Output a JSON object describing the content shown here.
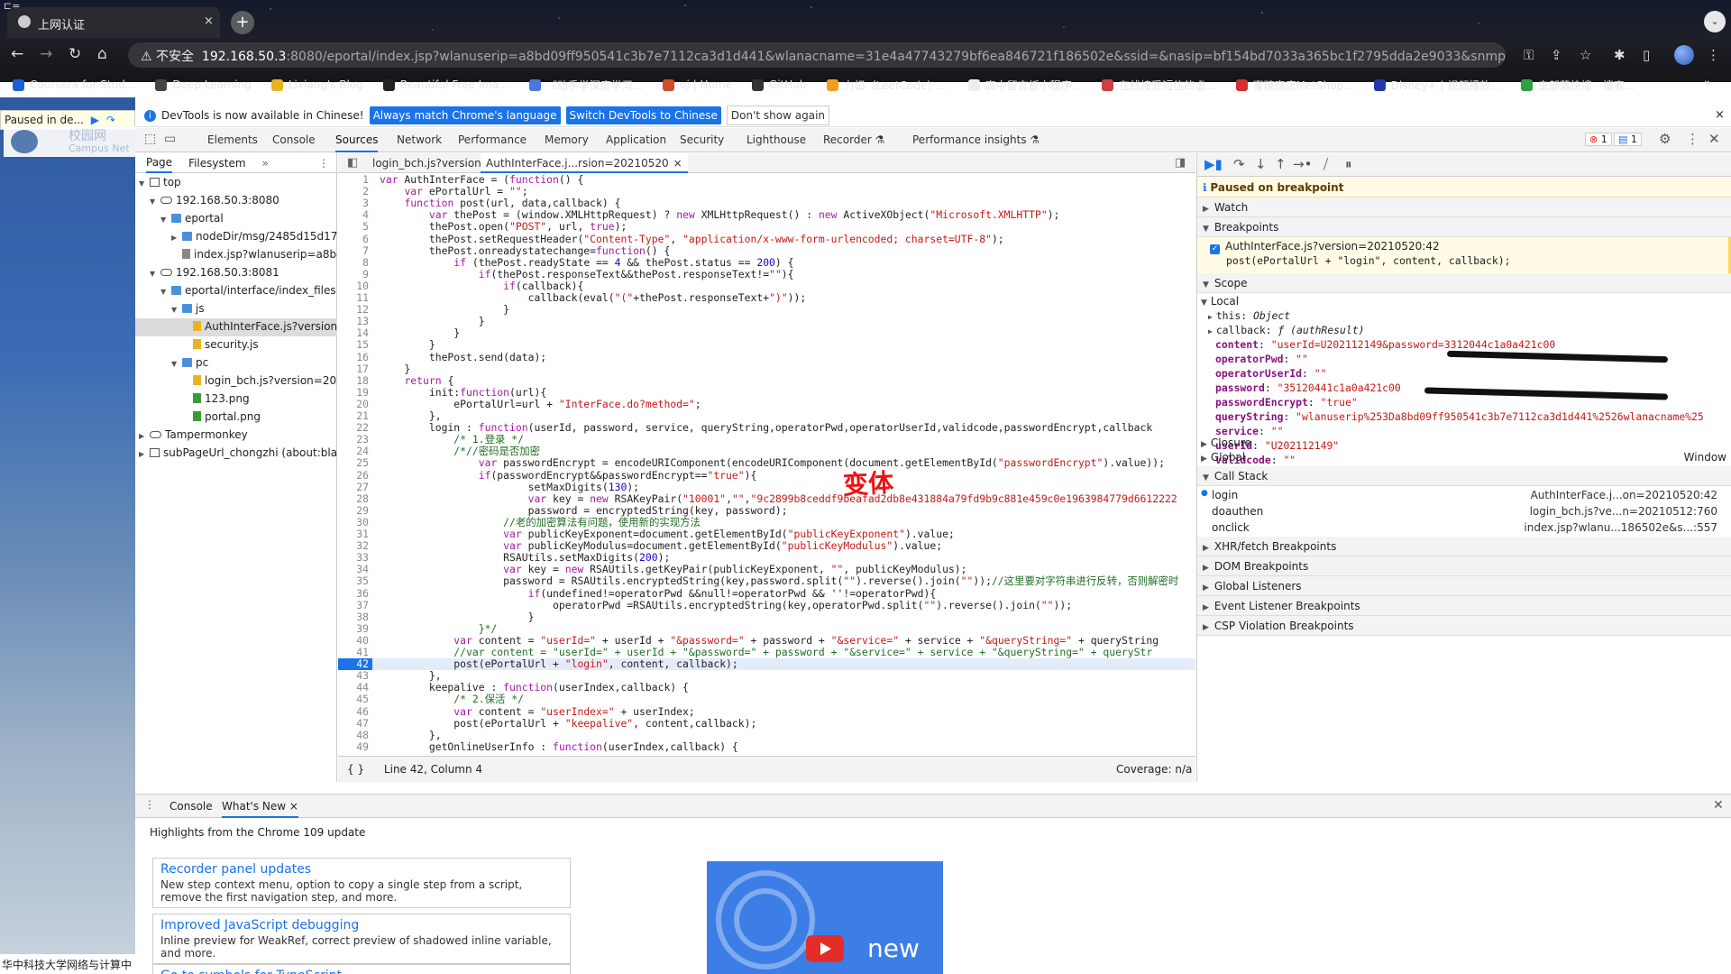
{
  "browser": {
    "tab_title": "上网认证",
    "tab_close": "×",
    "new_tab": "+",
    "url": {
      "warning": "不安全",
      "host": "192.168.50.3",
      "path": ":8080/eportal/index.jsp?wlanuserip=a8bd09ff950541c3b7e7112ca3d1d441&wlanacname=31e4a47743279bf6ea846721f186502e&ssid=&nasip=bf154bd7033a365bc1f2795dda2e9033&snmpagentip=&m..."
    },
    "bookmarks": [
      {
        "label": "Coursera for Stud...",
        "color": "#1f5fd6"
      },
      {
        "label": "Deep Learning",
        "color": "#444"
      },
      {
        "label": "Lixiang's Blog",
        "color": "#e8b41e"
      },
      {
        "label": "Beautiful Free Ima...",
        "color": "#222"
      },
      {
        "label": "《动手学深度学习...",
        "color": "#4a78d8"
      },
      {
        "label": "oj | Home",
        "color": "#d04e2c"
      },
      {
        "label": "GitHub",
        "color": "#333"
      },
      {
        "label": "力扣（LeetCode）...",
        "color": "#f0a020"
      },
      {
        "label": "高中留言板小程序...",
        "color": "#eee"
      },
      {
        "label": "在线接受短信的虚...",
        "color": "#c84040"
      },
      {
        "label": "蜜糖商店MetShop...",
        "color": "#d03030"
      },
      {
        "label": "Disney+ | 视频播放...",
        "color": "#2438a8"
      },
      {
        "label": "虫部落快搜 - 搜索...",
        "color": "#30a040"
      }
    ]
  },
  "page": {
    "paused_label": "Paused in de...",
    "campus_label": "校园网",
    "campus_sub": "Campus Net",
    "footer": "华中科技大学网络与计算中"
  },
  "infobar": {
    "text": "DevTools is now available in Chinese!",
    "btn_match": "Always match Chrome's language",
    "btn_switch": "Switch DevTools to Chinese",
    "btn_dont": "Don't show again",
    "close": "×"
  },
  "devtools": {
    "tabs": [
      "Elements",
      "Console",
      "Sources",
      "Network",
      "Performance",
      "Memory",
      "Application",
      "Security",
      "Lighthouse",
      "Recorder ⚗",
      "Performance insights ⚗"
    ],
    "active_tab": "Sources",
    "errors": "1",
    "messages": "1"
  },
  "navigator": {
    "tab_page": "Page",
    "tab_filesystem": "Filesystem",
    "more": "»",
    "tree": [
      {
        "label": "top",
        "indent": 0,
        "arrow": "▼",
        "kind": "frame"
      },
      {
        "label": "192.168.50.3:8080",
        "indent": 1,
        "arrow": "▼",
        "kind": "cloud"
      },
      {
        "label": "eportal",
        "indent": 2,
        "arrow": "▼",
        "kind": "folder"
      },
      {
        "label": "nodeDir/msg/2485d15d17a4",
        "indent": 3,
        "arrow": "▶",
        "kind": "folder"
      },
      {
        "label": "index.jsp?wlanuserip=a8bd0",
        "indent": 3,
        "arrow": "",
        "kind": "doc"
      },
      {
        "label": "192.168.50.3:8081",
        "indent": 1,
        "arrow": "▼",
        "kind": "cloud"
      },
      {
        "label": "eportal/interface/index_files",
        "indent": 2,
        "arrow": "▼",
        "kind": "folder"
      },
      {
        "label": "js",
        "indent": 3,
        "arrow": "▼",
        "kind": "folder"
      },
      {
        "label": "AuthInterFace.js?version=",
        "indent": 4,
        "arrow": "",
        "kind": "js",
        "selected": true
      },
      {
        "label": "security.js",
        "indent": 4,
        "arrow": "",
        "kind": "js"
      },
      {
        "label": "pc",
        "indent": 3,
        "arrow": "▼",
        "kind": "folder"
      },
      {
        "label": "login_bch.js?version=202",
        "indent": 4,
        "arrow": "",
        "kind": "js"
      },
      {
        "label": "123.png",
        "indent": 4,
        "arrow": "",
        "kind": "img"
      },
      {
        "label": "portal.png",
        "indent": 4,
        "arrow": "",
        "kind": "img"
      },
      {
        "label": "Tampermonkey",
        "indent": 0,
        "arrow": "▶",
        "kind": "cloud"
      },
      {
        "label": "subPageUrl_chongzhi (about:bla",
        "indent": 0,
        "arrow": "▶",
        "kind": "frame"
      }
    ]
  },
  "editor": {
    "tabs": [
      {
        "label": "login_bch.js?version=20210512",
        "active": false
      },
      {
        "label": "AuthInterFace.j...rsion=20210520",
        "active": true
      }
    ],
    "tab_close": "×",
    "status_position": "Line 42, Column 4",
    "status_coverage": "Coverage: n/a",
    "status_braces": "{ }",
    "overlay_text": "变体",
    "lines": [
      "var AuthInterFace = (function() {",
      "    var ePortalUrl = \"\";",
      "    function post(url, data,callback) {",
      "        var thePost = (window.XMLHttpRequest) ? new XMLHttpRequest() : new ActiveXObject(\"Microsoft.XMLHTTP\");",
      "        thePost.open(\"POST\", url, true);",
      "        thePost.setRequestHeader(\"Content-Type\", \"application/x-www-form-urlencoded; charset=UTF-8\");",
      "        thePost.onreadystatechange=function() {",
      "            if (thePost.readyState == 4 && thePost.status == 200) {",
      "                if(thePost.responseText&&thePost.responseText!=\"\"){",
      "                    if(callback){",
      "                        callback(eval(\"(\"+thePost.responseText+\")\"));",
      "                    }",
      "                }",
      "            }",
      "        }",
      "        thePost.send(data);",
      "    }",
      "    return {",
      "        init:function(url){",
      "            ePortalUrl=url + \"InterFace.do?method=\";",
      "        },",
      "        login : function(userId, password, service, queryString,operatorPwd,operatorUserId,validcode,passwordEncrypt,callback",
      "            /* 1.登录 */",
      "            /*//密码是否加密",
      "                var passwordEncrypt = encodeURIComponent(encodeURIComponent(document.getElementById(\"passwordEncrypt\").value));",
      "                if(passwordEncrypt&&passwordEncrypt==\"true\"){",
      "                        setMaxDigits(130);",
      "                        var key = new RSAKeyPair(\"10001\",\"\",\"9c2899b8ceddf9beafad2db8e431884a79fd9b9c881e459c0e1963984779d6612222",
      "                        password = encryptedString(key, password);",
      "                    //老的加密算法有问题，使用新的实现方法",
      "                    var publicKeyExponent=document.getElementById(\"publicKeyExponent\").value;",
      "                    var publicKeyModulus=document.getElementById(\"publicKeyModulus\").value;",
      "                    RSAUtils.setMaxDigits(200);",
      "                    var key = new RSAUtils.getKeyPair(publicKeyExponent, \"\", publicKeyModulus);",
      "                    password = RSAUtils.encryptedString(key,password.split(\"\").reverse().join(\"\"));//这里要对字符串进行反转，否则解密时",
      "                        if(undefined!=operatorPwd &&null!=operatorPwd && ''!=operatorPwd){",
      "                            operatorPwd =RSAUtils.encryptedString(key,operatorPwd.split(\"\").reverse().join(\"\"));",
      "                        }",
      "                }*/",
      "            var content = \"userId=\" + userId + \"&password=\" + password + \"&service=\" + service + \"&queryString=\" + queryString",
      "            //var content = \"userId=\" + userId + \"&password=\" + password + \"&service=\" + service + \"&queryString=\" + queryStr",
      "            post(ePortalUrl + \"login\", content, callback);",
      "        },",
      "        keepalive : function(userIndex,callback) {",
      "            /* 2.保活 */",
      "            var content = \"userIndex=\" + userIndex;",
      "            post(ePortalUrl + \"keepalive\", content,callback);",
      "        },",
      "        getOnlineUserInfo : function(userIndex,callback) {"
    ],
    "highlight_line": 42
  },
  "debugger": {
    "paused_msg": "Paused on breakpoint",
    "watch": "Watch",
    "breakpoints": "Breakpoints",
    "bp_file": "AuthInterFace.js?version=20210520:42",
    "bp_code": "post(ePortalUrl + \"login\", content, callback);",
    "scope": "Scope",
    "local": "Local",
    "scope_vars": [
      {
        "name": "this",
        "value": "Object",
        "arrow": "▶",
        "plain": true
      },
      {
        "name": "callback",
        "value": "ƒ (authResult)",
        "arrow": "▶",
        "plain": true
      },
      {
        "name": "content",
        "value": "\"userId=U202112149&password=3312044c1a0a421c00",
        "arrow": "",
        "plain": false
      },
      {
        "name": "operatorPwd",
        "value": "\"\"",
        "arrow": "",
        "plain": false
      },
      {
        "name": "operatorUserId",
        "value": "\"\"",
        "arrow": "",
        "plain": false
      },
      {
        "name": "password",
        "value": "\"35120441c1a0a421c00",
        "arrow": "",
        "plain": false
      },
      {
        "name": "passwordEncrypt",
        "value": "\"true\"",
        "arrow": "",
        "plain": false
      },
      {
        "name": "queryString",
        "value": "\"wlanuserip%253Da8bd09ff950541c3b7e7112ca3d1d441%2526wlanacname%25",
        "arrow": "",
        "plain": false
      },
      {
        "name": "service",
        "value": "\"\"",
        "arrow": "",
        "plain": false
      },
      {
        "name": "userId",
        "value": "\"U202112149\"",
        "arrow": "",
        "plain": false
      },
      {
        "name": "validcode",
        "value": "\"\"",
        "arrow": "",
        "plain": false
      }
    ],
    "closure": "Closure",
    "global": "Global",
    "global_value": "Window",
    "callstack": "Call Stack",
    "frames": [
      {
        "name": "login",
        "loc": "AuthInterFace.j...on=20210520:42",
        "current": true
      },
      {
        "name": "doauthen",
        "loc": "login_bch.js?ve...n=20210512:760",
        "current": false
      },
      {
        "name": "onclick",
        "loc": "index.jsp?wlanu...186502e&s...:557",
        "current": false
      }
    ],
    "more_sections": [
      "XHR/fetch Breakpoints",
      "DOM Breakpoints",
      "Global Listeners",
      "Event Listener Breakpoints",
      "CSP Violation Breakpoints"
    ]
  },
  "drawer": {
    "tab_console": "Console",
    "tab_whatsnew": "What's New",
    "close": "×",
    "headline": "Highlights from the Chrome 109 update",
    "cards": [
      {
        "title": "Recorder panel updates",
        "desc": "New step context menu, option to copy a single step from a script, remove the first navigation step, and more."
      },
      {
        "title": "Improved JavaScript debugging",
        "desc": "Inline preview for WeakRef, correct preview of shadowed inline variable, and more."
      },
      {
        "title": "Go to symbols for TypeScript",
        "desc": ""
      }
    ],
    "video_label": "new"
  }
}
